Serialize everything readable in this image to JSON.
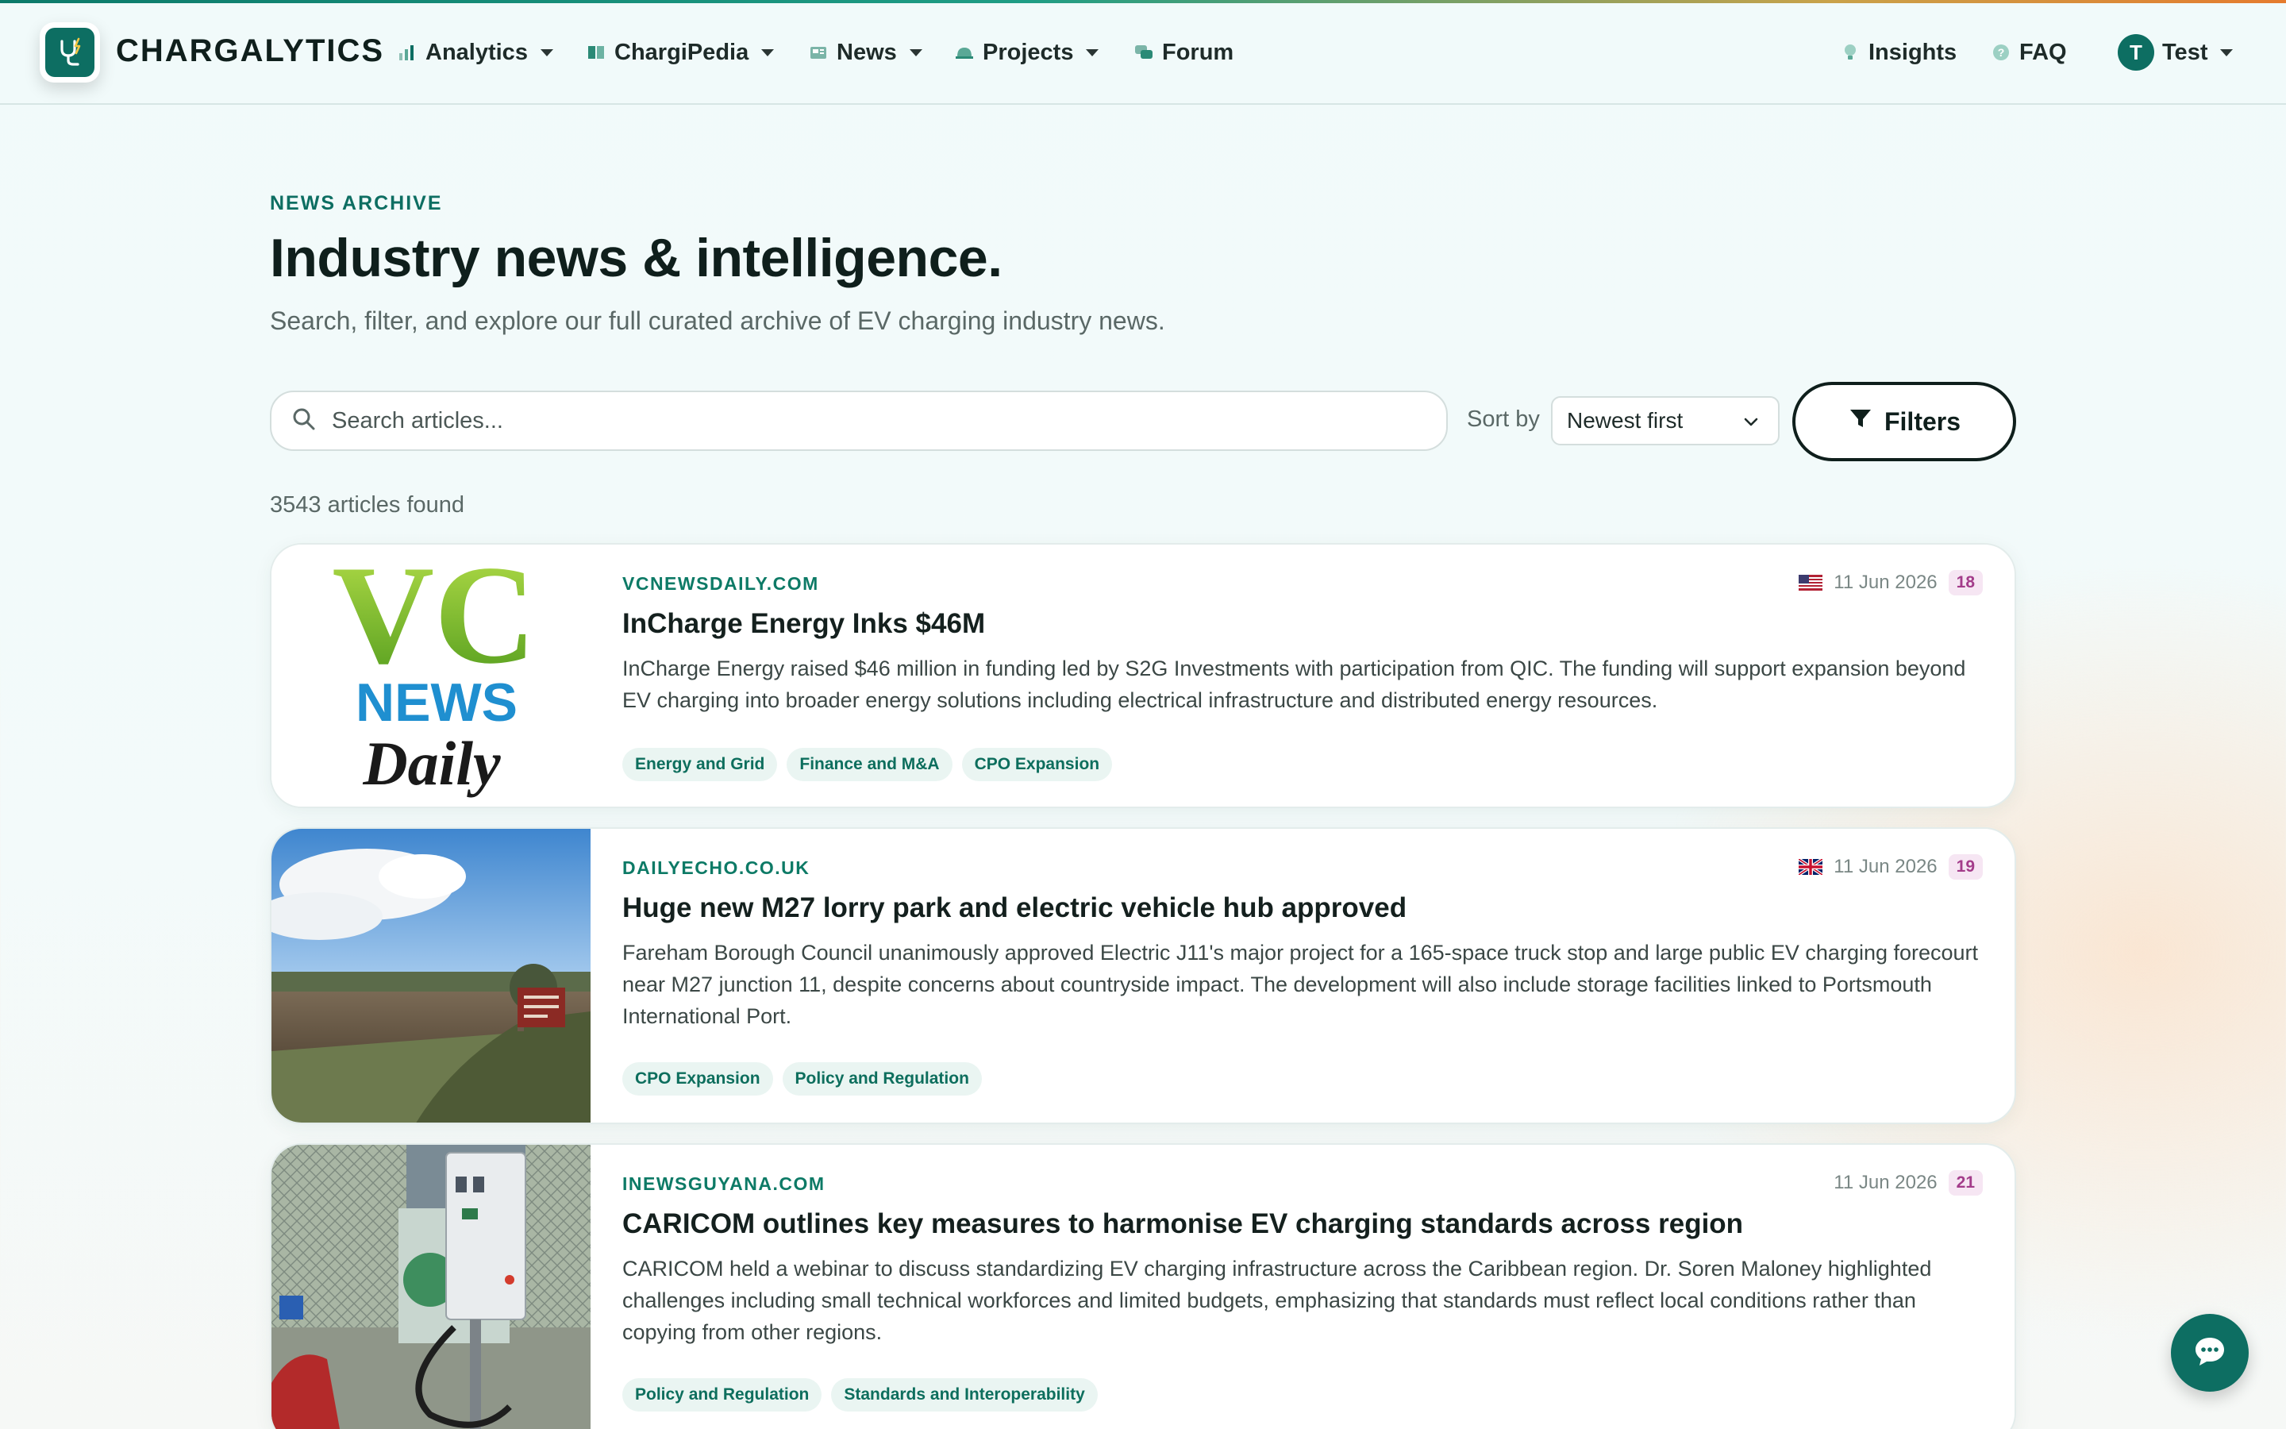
{
  "nav": {
    "brand": "CHARGALYTICS",
    "items": [
      {
        "label": "Analytics",
        "icon": "analytics-icon"
      },
      {
        "label": "ChargiPedia",
        "icon": "book-icon"
      },
      {
        "label": "News",
        "icon": "newspaper-icon"
      },
      {
        "label": "Projects",
        "icon": "hardhat-icon"
      },
      {
        "label": "Forum",
        "icon": "chat-bubbles-icon"
      }
    ],
    "right": {
      "insights": "Insights",
      "faq": "FAQ",
      "user_initial": "T",
      "user_name": "Test"
    }
  },
  "header": {
    "eyebrow": "NEWS ARCHIVE",
    "title": "Industry news & intelligence.",
    "subtitle": "Search, filter, and explore our full curated archive of EV charging industry news."
  },
  "search": {
    "placeholder": "Search articles...",
    "sort_label": "Sort by",
    "sort_value": "Newest first",
    "filters_label": "Filters"
  },
  "results": {
    "count_text": "3543 articles found"
  },
  "articles": [
    {
      "source": "VCNEWSDAILY.COM",
      "date": "11 Jun 2026",
      "count": "18",
      "flag": "us",
      "thumb_logo": {
        "line1": "VC",
        "line2": "NEWS",
        "line3": "Daily"
      },
      "title": "InCharge Energy Inks $46M",
      "summary": "InCharge Energy raised $46 million in funding led by S2G Investments with participation from QIC. The funding will support expansion beyond EV charging into broader energy solutions including electrical infrastructure and distributed energy resources.",
      "tags": [
        "Energy and Grid",
        "Finance and M&A",
        "CPO Expansion"
      ]
    },
    {
      "source": "DAILYECHO.CO.UK",
      "date": "11 Jun 2026",
      "count": "19",
      "flag": "uk",
      "title": "Huge new M27 lorry park and electric vehicle hub approved",
      "summary": "Fareham Borough Council unanimously approved Electric J11's major project for a 165-space truck stop and large public EV charging forecourt near M27 junction 11, despite concerns about countryside impact. The development will also include storage facilities linked to Portsmouth International Port.",
      "tags": [
        "CPO Expansion",
        "Policy and Regulation"
      ]
    },
    {
      "source": "INEWSGUYANA.COM",
      "date": "11 Jun 2026",
      "count": "21",
      "title": "CARICOM outlines key measures to harmonise EV charging standards across region",
      "summary": "CARICOM held a webinar to discuss standardizing EV charging infrastructure across the Caribbean region. Dr. Soren Maloney highlighted challenges including small technical workforces and limited budgets, emphasizing that standards must reflect local conditions rather than copying from other regions.",
      "tags": [
        "Policy and Regulation",
        "Standards and Interoperability"
      ]
    }
  ],
  "colors": {
    "brand": "#0d6e62",
    "accent_text": "#0d7a66",
    "badge_bg": "#f6e6f3",
    "badge_text": "#a33c8a"
  }
}
